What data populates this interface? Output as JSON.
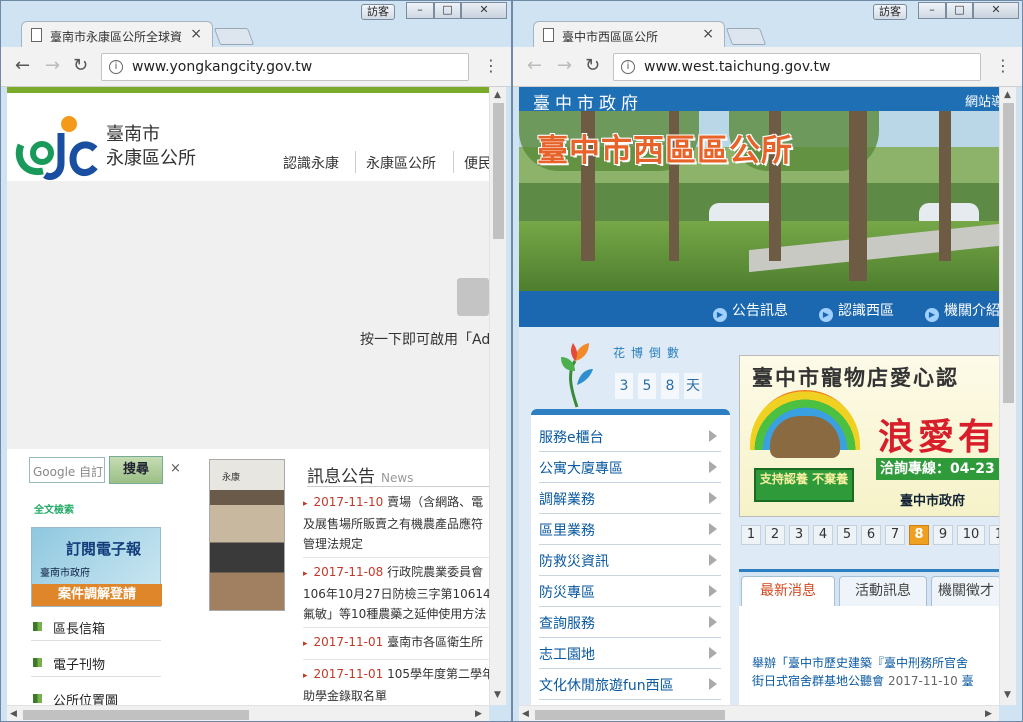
{
  "left_window": {
    "guest_label": "訪客",
    "controls": {
      "min": "–",
      "max": "□",
      "close": "✕"
    },
    "tab_title": "臺南市永康區公所全球資",
    "tab_close": "×",
    "url": "www.yongkangcity.gov.tw",
    "info_icon": "i",
    "page": {
      "site_name_line1": "臺南市",
      "site_name_line2": "永康區公所",
      "nav": [
        "認識永康",
        "永康區公所",
        "便民"
      ],
      "plugin_message": "按一下即可啟用「Ado",
      "search_placeholder": "Google 自訂",
      "search_button": "搜尋",
      "search_close": "×",
      "fulltext_label": "全文檢索",
      "ebanner": {
        "title": "訂閱電子報",
        "subtitle": "臺南市政府",
        "cta": "案件調解登請"
      },
      "side_links": [
        "區長信箱",
        "電子刊物",
        "公所位置圖"
      ],
      "photo_sign": "永康",
      "news_title": "訊息公告",
      "news_title_en": "News",
      "news": [
        {
          "date": "2017-11-10",
          "lines": [
            "賣場（含網路、電",
            "及展售場所販賣之有機農產品應符",
            "管理法規定"
          ]
        },
        {
          "date": "2017-11-08",
          "lines": [
            "行政院農業委員會",
            "106年10月27日防檢三字第10614",
            "氟敏」等10種農藥之延伸使用方法"
          ]
        },
        {
          "date": "2017-11-01",
          "lines": [
            "臺南市各區衛生所"
          ]
        },
        {
          "date": "2017-11-01",
          "lines": [
            "105學年度第二學年",
            "助學金錄取名單"
          ]
        }
      ]
    }
  },
  "right_window": {
    "guest_label": "訪客",
    "controls": {
      "min": "–",
      "max": "□",
      "close": "✕"
    },
    "tab_title": "臺中市西區區公所",
    "tab_close": "×",
    "url": "www.west.taichung.gov.tw",
    "info_icon": "i",
    "page": {
      "gov_title": "臺中市政府",
      "gov_menu": "網站導",
      "hero_title": "臺中市西區區公所",
      "nav": [
        "公告訊息",
        "認識西區",
        "機關介紹"
      ],
      "expo_title": "花博倒數",
      "countdown": [
        "3",
        "5",
        "8",
        "天"
      ],
      "menu": [
        "服務e櫃台",
        "公寓大廈專區",
        "調解業務",
        "區里業務",
        "防救災資訊",
        "防災專區",
        "查詢服務",
        "志工園地",
        "文化休閒旅遊fun西區"
      ],
      "pet_banner": {
        "title": "臺中市寵物店愛心認",
        "slogan": "浪愛有",
        "hotline": "洽詢專線：04-23",
        "sign": "支持認養 不棄養",
        "org": "臺中市政府"
      },
      "pager": [
        "1",
        "2",
        "3",
        "4",
        "5",
        "6",
        "7",
        "8",
        "9",
        "10",
        "1"
      ],
      "pager_active": "8",
      "tabs": [
        "最新消息",
        "活動訊息",
        "機關徵才"
      ],
      "news_line1": "舉辦「臺中市歷史建築『臺中刑務所官舍",
      "news_line2": "街日式宿舍群基地公聽會",
      "news_date": "2017-11-10",
      "news_tail": "臺"
    }
  },
  "colors": {
    "left_accent": "#7aaa2a",
    "right_accent": "#1f6fb5",
    "date_red": "#c0392b",
    "hero_title_orange": "#e8632a"
  }
}
